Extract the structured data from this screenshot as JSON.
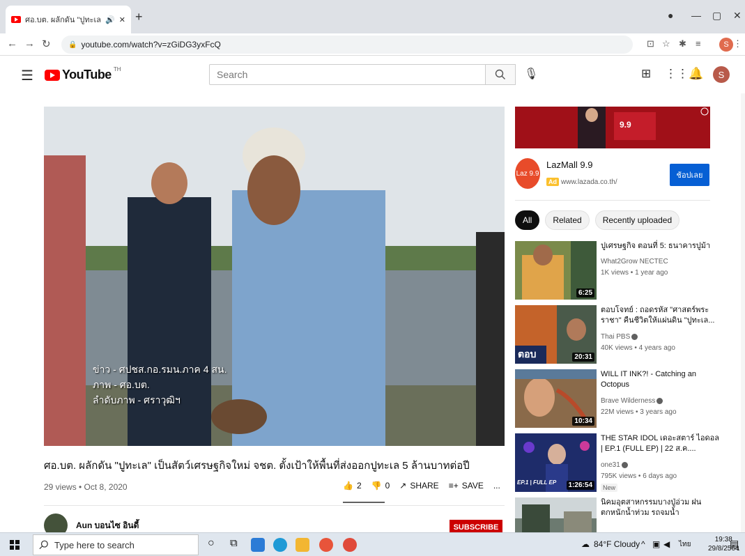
{
  "browser": {
    "tab_title": "ศอ.บต. ผลักดัน \"ปูทะเล\" เป็นสัตว์",
    "tab_audio_icon": "speaker-icon",
    "url": "youtube.com/watch?v=zGiDG3yxFcQ",
    "profile_initial": "S"
  },
  "youtube": {
    "logo_text": "YouTube",
    "country_code": "TH",
    "search_placeholder": "Search",
    "avatar_initial": "S"
  },
  "video": {
    "caption_lines": [
      "ข่าว - ศปชส.กอ.รมน.ภาค 4 สน.",
      "ภาพ - ศอ.บต.",
      "ลำดับภาพ - ศราวุฒิฯ"
    ],
    "title": "ศอ.บต. ผลักดัน \"ปูทะเล\" เป็นสัตว์เศรษฐกิจใหม่ จชต. ตั้งเป้าให้พื้นที่ส่งออกปูทะเล 5 ล้านบาทต่อปี",
    "meta": "29 views • Oct 8, 2020",
    "likes": "2",
    "dislikes": "0",
    "share_label": "SHARE",
    "save_label": "SAVE",
    "more_label": "...",
    "channel_name": "Aun บอนไซ อินดี้",
    "subscribe_label": "SUBSCRIBE"
  },
  "ad": {
    "name": "LazMall 9.9",
    "badge": "Ad",
    "url": "www.lazada.co.th/",
    "cta": "ช้อปเลย",
    "logo_text": "Laz 9.9",
    "banner_text": "9.9"
  },
  "chips": [
    "All",
    "Related",
    "Recently uploaded"
  ],
  "recommendations": [
    {
      "title": "ปูเศรษฐกิจ ตอนที่ 5: ธนาคารปูม้า",
      "channel": "What2Grow NECTEC",
      "views": "1K views • 1 year ago",
      "duration": "6:25",
      "verified": false,
      "new": false,
      "thumb_color": "#7a8a4a"
    },
    {
      "title": "ตอบโจทย์ : ถอดรหัส \"ศาสตร์พระราชา\" คืนชีวิตให้แผ่นดิน \"ปูทะเล...",
      "channel": "Thai PBS",
      "views": "40K views • 4 years ago",
      "duration": "20:31",
      "verified": true,
      "new": false,
      "thumb_color": "#c4632a",
      "thumb_label": "ตอบ"
    },
    {
      "title": "WILL IT INK?! - Catching an Octopus",
      "channel": "Brave Wilderness",
      "views": "22M views • 3 years ago",
      "duration": "10:34",
      "verified": true,
      "new": false,
      "thumb_color": "#8a6a4a"
    },
    {
      "title": "THE STAR IDOL เดอะสตาร์ ไอดอล | EP.1 (FULL EP) | 22 ส.ค....",
      "channel": "one31",
      "views": "795K views • 6 days ago",
      "duration": "1:26:54",
      "verified": true,
      "new": true,
      "new_label": "New",
      "thumb_color": "#1e2c6a",
      "thumb_label": "EP.1 | FULL EP"
    },
    {
      "title": "นิคมอุตสาหกรรมบางปู่อ่วม ฝนตกหนักน้ำท่วม รถจมน้ำ",
      "channel": "",
      "views": "",
      "duration": "",
      "verified": true,
      "new": false,
      "thumb_color": "#6c7a70"
    }
  ],
  "taskbar": {
    "search_placeholder": "Type here to search",
    "weather": "84°F Cloudy",
    "lang": "ไทย",
    "time": "19:38",
    "date": "29/8/2564",
    "notification_count": "1"
  }
}
